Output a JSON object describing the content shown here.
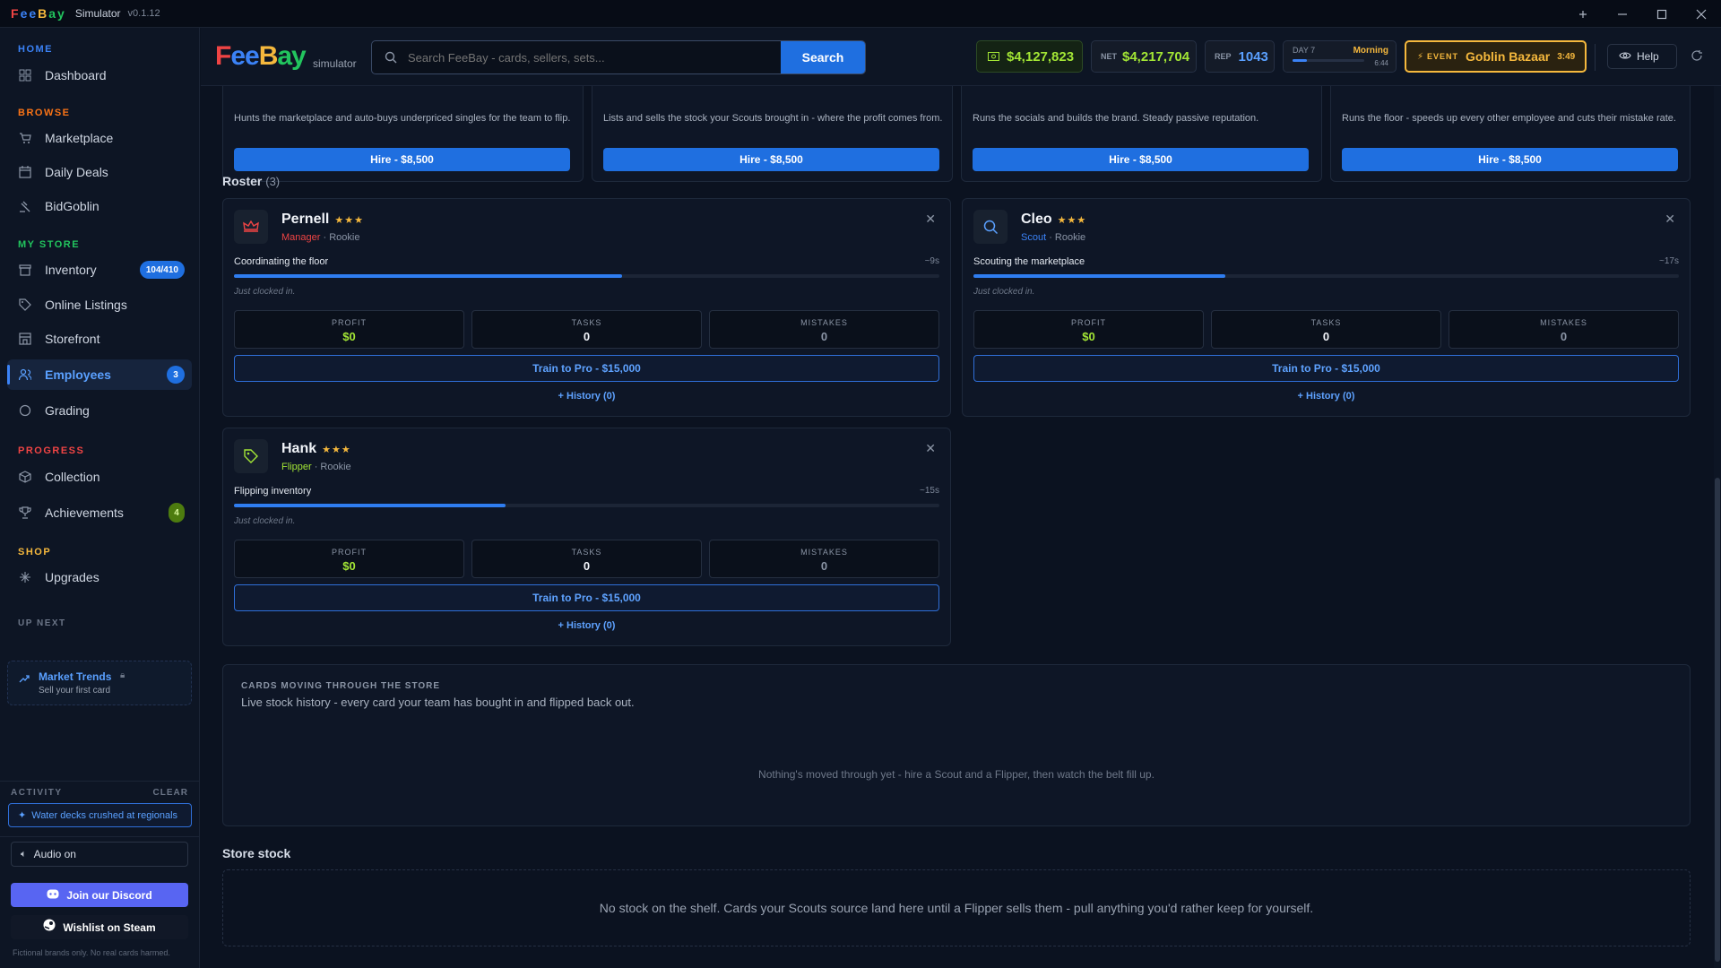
{
  "titlebar": {
    "logo": "FeeBay",
    "app": "Simulator",
    "version": "v0.1.12"
  },
  "sidebar": {
    "sections": {
      "home": "HOME",
      "browse": "BROWSE",
      "my_store": "MY STORE",
      "progress": "PROGRESS",
      "shop": "SHOP",
      "up_next": "UP NEXT",
      "activity": "ACTIVITY"
    },
    "items": [
      {
        "label": "Dashboard"
      },
      {
        "label": "Marketplace"
      },
      {
        "label": "Daily Deals"
      },
      {
        "label": "BidGoblin"
      },
      {
        "label": "Inventory",
        "badge": "104/410"
      },
      {
        "label": "Online Listings"
      },
      {
        "label": "Storefront"
      },
      {
        "label": "Employees",
        "badge": "3"
      },
      {
        "label": "Grading"
      },
      {
        "label": "Collection"
      },
      {
        "label": "Achievements",
        "badge": "4"
      },
      {
        "label": "Upgrades"
      }
    ],
    "up_next": {
      "title": "Market Trends",
      "subtitle": "Sell your first card"
    },
    "activity": {
      "clear": "CLEAR",
      "message": "Water decks crushed at regionals"
    },
    "audio": "Audio on",
    "discord": "Join our Discord",
    "steam": "Wishlist on Steam",
    "footer": "Fictional brands only. No real cards harmed."
  },
  "topbar": {
    "brand": "FeeBay",
    "brand_sub": "simulator",
    "search_placeholder": "Search FeeBay - cards, sellers, sets...",
    "search_button": "Search",
    "cash": "$4,127,823",
    "net_label": "NET",
    "net": "$4,217,704",
    "rep_label": "REP",
    "rep": "1043",
    "day": "DAY 7",
    "time_of_day": "Morning",
    "clock": "6:44",
    "day_progress": 0.2,
    "event_label": "EVENT",
    "event_name": "Goblin Bazaar",
    "event_timer": "3:49",
    "help": "Help"
  },
  "hire_cards": [
    {
      "desc": "Hunts the marketplace and auto-buys underpriced singles for the team to flip.",
      "button": "Hire - $8,500"
    },
    {
      "desc": "Lists and sells the stock your Scouts brought in - where the profit comes from.",
      "button": "Hire - $8,500"
    },
    {
      "desc": "Runs the socials and builds the brand. Steady passive reputation.",
      "button": "Hire - $8,500"
    },
    {
      "desc": "Runs the floor - speeds up every other employee and cuts their mistake rate.",
      "button": "Hire - $8,500"
    }
  ],
  "roster": {
    "title": "Roster",
    "count": "(3)",
    "employees": [
      {
        "name": "Pernell",
        "stars": "★★★",
        "role": "Manager",
        "role_color": "#ef4444",
        "rank": "· Rookie",
        "task": "Coordinating the floor",
        "eta": "~9s",
        "progress": 0.55,
        "clocked": "Just clocked in.",
        "profit_label": "PROFIT",
        "profit": "$0",
        "tasks_label": "TASKS",
        "tasks": "0",
        "mistakes_label": "MISTAKES",
        "mistakes": "0",
        "train": "Train to Pro - $15,000",
        "history": "History (0)",
        "icon": "crown-icon"
      },
      {
        "name": "Cleo",
        "stars": "★★★",
        "role": "Scout",
        "role_color": "#3b82f6",
        "rank": "· Rookie",
        "task": "Scouting the marketplace",
        "eta": "~17s",
        "progress": 0.357,
        "clocked": "Just clocked in.",
        "profit_label": "PROFIT",
        "profit": "$0",
        "tasks_label": "TASKS",
        "tasks": "0",
        "mistakes_label": "MISTAKES",
        "mistakes": "0",
        "train": "Train to Pro - $15,000",
        "history": "History (0)",
        "icon": "search-icon"
      },
      {
        "name": "Hank",
        "stars": "★★★",
        "role": "Flipper",
        "role_color": "#a3e635",
        "rank": "· Rookie",
        "task": "Flipping inventory",
        "eta": "~15s",
        "progress": 0.385,
        "clocked": "Just clocked in.",
        "profit_label": "PROFIT",
        "profit": "$0",
        "tasks_label": "TASKS",
        "tasks": "0",
        "mistakes_label": "MISTAKES",
        "mistakes": "0",
        "train": "Train to Pro - $15,000",
        "history": "History (0)",
        "icon": "tag-icon"
      }
    ]
  },
  "moving": {
    "heading": "CARDS MOVING THROUGH THE STORE",
    "sub": "Live stock history - every card your team has bought in and flipped back out.",
    "empty": "Nothing's moved through yet - hire a Scout and a Flipper, then watch the belt fill up."
  },
  "stock": {
    "title": "Store stock",
    "empty": "No stock on the shelf. Cards your Scouts source land here until a Flipper sells them - pull anything you'd rather keep for yourself."
  }
}
